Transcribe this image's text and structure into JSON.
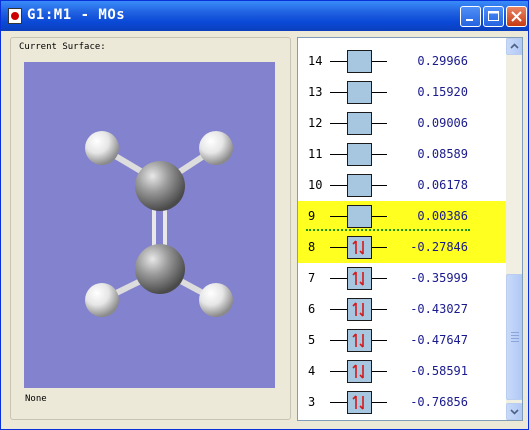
{
  "window": {
    "title": "G1:M1 - MOs"
  },
  "surface": {
    "label": "Current Surface:",
    "status": "None"
  },
  "orbitals": [
    {
      "num": "14",
      "energy": "0.29966",
      "occupied": false,
      "highlight": false
    },
    {
      "num": "13",
      "energy": "0.15920",
      "occupied": false,
      "highlight": false
    },
    {
      "num": "12",
      "energy": "0.09006",
      "occupied": false,
      "highlight": false
    },
    {
      "num": "11",
      "energy": "0.08589",
      "occupied": false,
      "highlight": false
    },
    {
      "num": "10",
      "energy": "0.06178",
      "occupied": false,
      "highlight": false
    },
    {
      "num": "9",
      "energy": "0.00386",
      "occupied": false,
      "highlight": true
    },
    {
      "num": "8",
      "energy": "-0.27846",
      "occupied": true,
      "highlight": true
    },
    {
      "num": "7",
      "energy": "-0.35999",
      "occupied": true,
      "highlight": false
    },
    {
      "num": "6",
      "energy": "-0.43027",
      "occupied": true,
      "highlight": false
    },
    {
      "num": "5",
      "energy": "-0.47647",
      "occupied": true,
      "highlight": false
    },
    {
      "num": "4",
      "energy": "-0.58591",
      "occupied": true,
      "highlight": false
    },
    {
      "num": "3",
      "energy": "-0.76856",
      "occupied": true,
      "highlight": false
    }
  ],
  "colors": {
    "viewport_bg": "#8282cf",
    "highlight": "#ffff20",
    "orbital_box": "#a7c6e0",
    "electron_arrow": "#d41a1a",
    "energy_text": "#1a1a8c"
  }
}
